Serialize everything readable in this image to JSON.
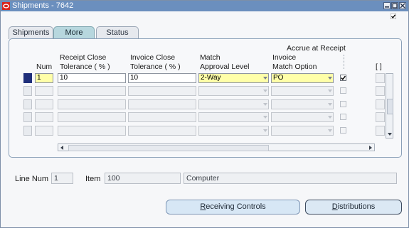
{
  "window": {
    "title": "Shipments - 7642"
  },
  "tabs": [
    {
      "label": "Shipments",
      "active": false
    },
    {
      "label": "More",
      "active": true
    },
    {
      "label": "Status",
      "active": false
    }
  ],
  "columns": {
    "num": "Num",
    "receipt_close_line1": "Receipt Close",
    "receipt_close_line2": "Tolerance ( % )",
    "invoice_close_line1": "Invoice Close",
    "invoice_close_line2": "Tolerance ( % )",
    "match_line1": "Match",
    "match_line2": "Approval Level",
    "accrue": "Accrue at Receipt",
    "invoice_match_line1": "Invoice",
    "invoice_match_line2": "Match Option",
    "folder": "[ ]"
  },
  "rows": [
    {
      "num": "1",
      "receipt_close": "10",
      "invoice_close": "10",
      "match_level": "2-Way",
      "invoice_match": "PO",
      "accrue": true
    }
  ],
  "line": {
    "line_num_label": "Line Num",
    "line_num_value": "1",
    "item_label": "Item",
    "item_value": "100",
    "description": "Computer"
  },
  "buttons": {
    "receiving_controls_prefix": "R",
    "receiving_controls_rest": "eceiving Controls",
    "distributions_prefix": "D",
    "distributions_rest": "istributions"
  },
  "colors": {
    "titlebar": "#6b8fbe",
    "active_tab": "#b7d7de",
    "required_field": "#ffffa8",
    "current_record": "#1f2f7a",
    "button": "#d7e7f5"
  }
}
